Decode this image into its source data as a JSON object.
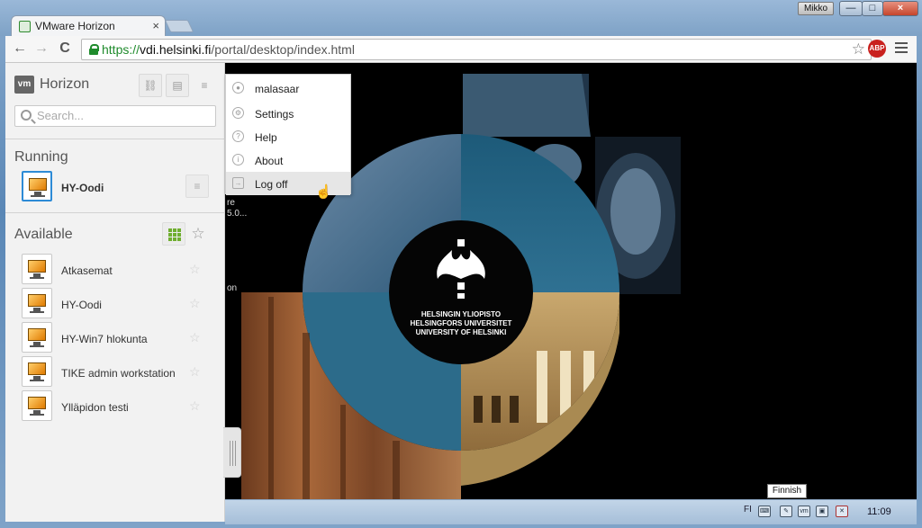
{
  "window": {
    "tab_title": "VMware Horizon",
    "tab_close": "×",
    "user_badge": "Mikko",
    "minimize": "—",
    "maximize": "□",
    "close": "×"
  },
  "toolbar": {
    "back": "←",
    "forward": "→",
    "reload": "C",
    "url_scheme": "https://",
    "url_host": "vdi.helsinki.fi",
    "url_path": "/portal/desktop/index.html",
    "bookmark_star": "☆",
    "abp_label": "ABP"
  },
  "sidebar": {
    "brand_logo": "vm",
    "brand_name": "Horizon",
    "list_glyph": "≡",
    "search_placeholder": "Search...",
    "running_heading": "Running",
    "running_items": [
      {
        "label": "HY-Oodi"
      }
    ],
    "available_heading": "Available",
    "favorite_glyph": "☆",
    "available_items": [
      {
        "label": "Atkasemat"
      },
      {
        "label": "HY-Oodi"
      },
      {
        "label": "HY-Win7 hlokunta"
      },
      {
        "label": "TIKE admin workstation"
      },
      {
        "label": "Ylläpidon testi"
      }
    ]
  },
  "menu": {
    "username": "malasaar",
    "items": [
      {
        "label": "Settings",
        "glyph": "⚙"
      },
      {
        "label": "Help",
        "glyph": "?"
      },
      {
        "label": "About",
        "glyph": "i"
      },
      {
        "label": "Log off",
        "glyph": "→"
      }
    ]
  },
  "background": {
    "logo_line1": "HELSINGIN YLIOPISTO",
    "logo_line2": "HELSINGFORS UNIVERSITET",
    "logo_line3": "UNIVERSITY OF HELSINKI",
    "fragment_text1": "re",
    "fragment_text2": "5.0...",
    "fragment_text3": "on"
  },
  "taskbar": {
    "language": "FI",
    "tooltip": "Finnish",
    "clock": "11:09"
  },
  "colors": {
    "accent_blue": "#2d8bd6",
    "grid_green": "#6fae2f",
    "abp_red": "#c9211e",
    "secure_green": "#1f8b2c"
  }
}
